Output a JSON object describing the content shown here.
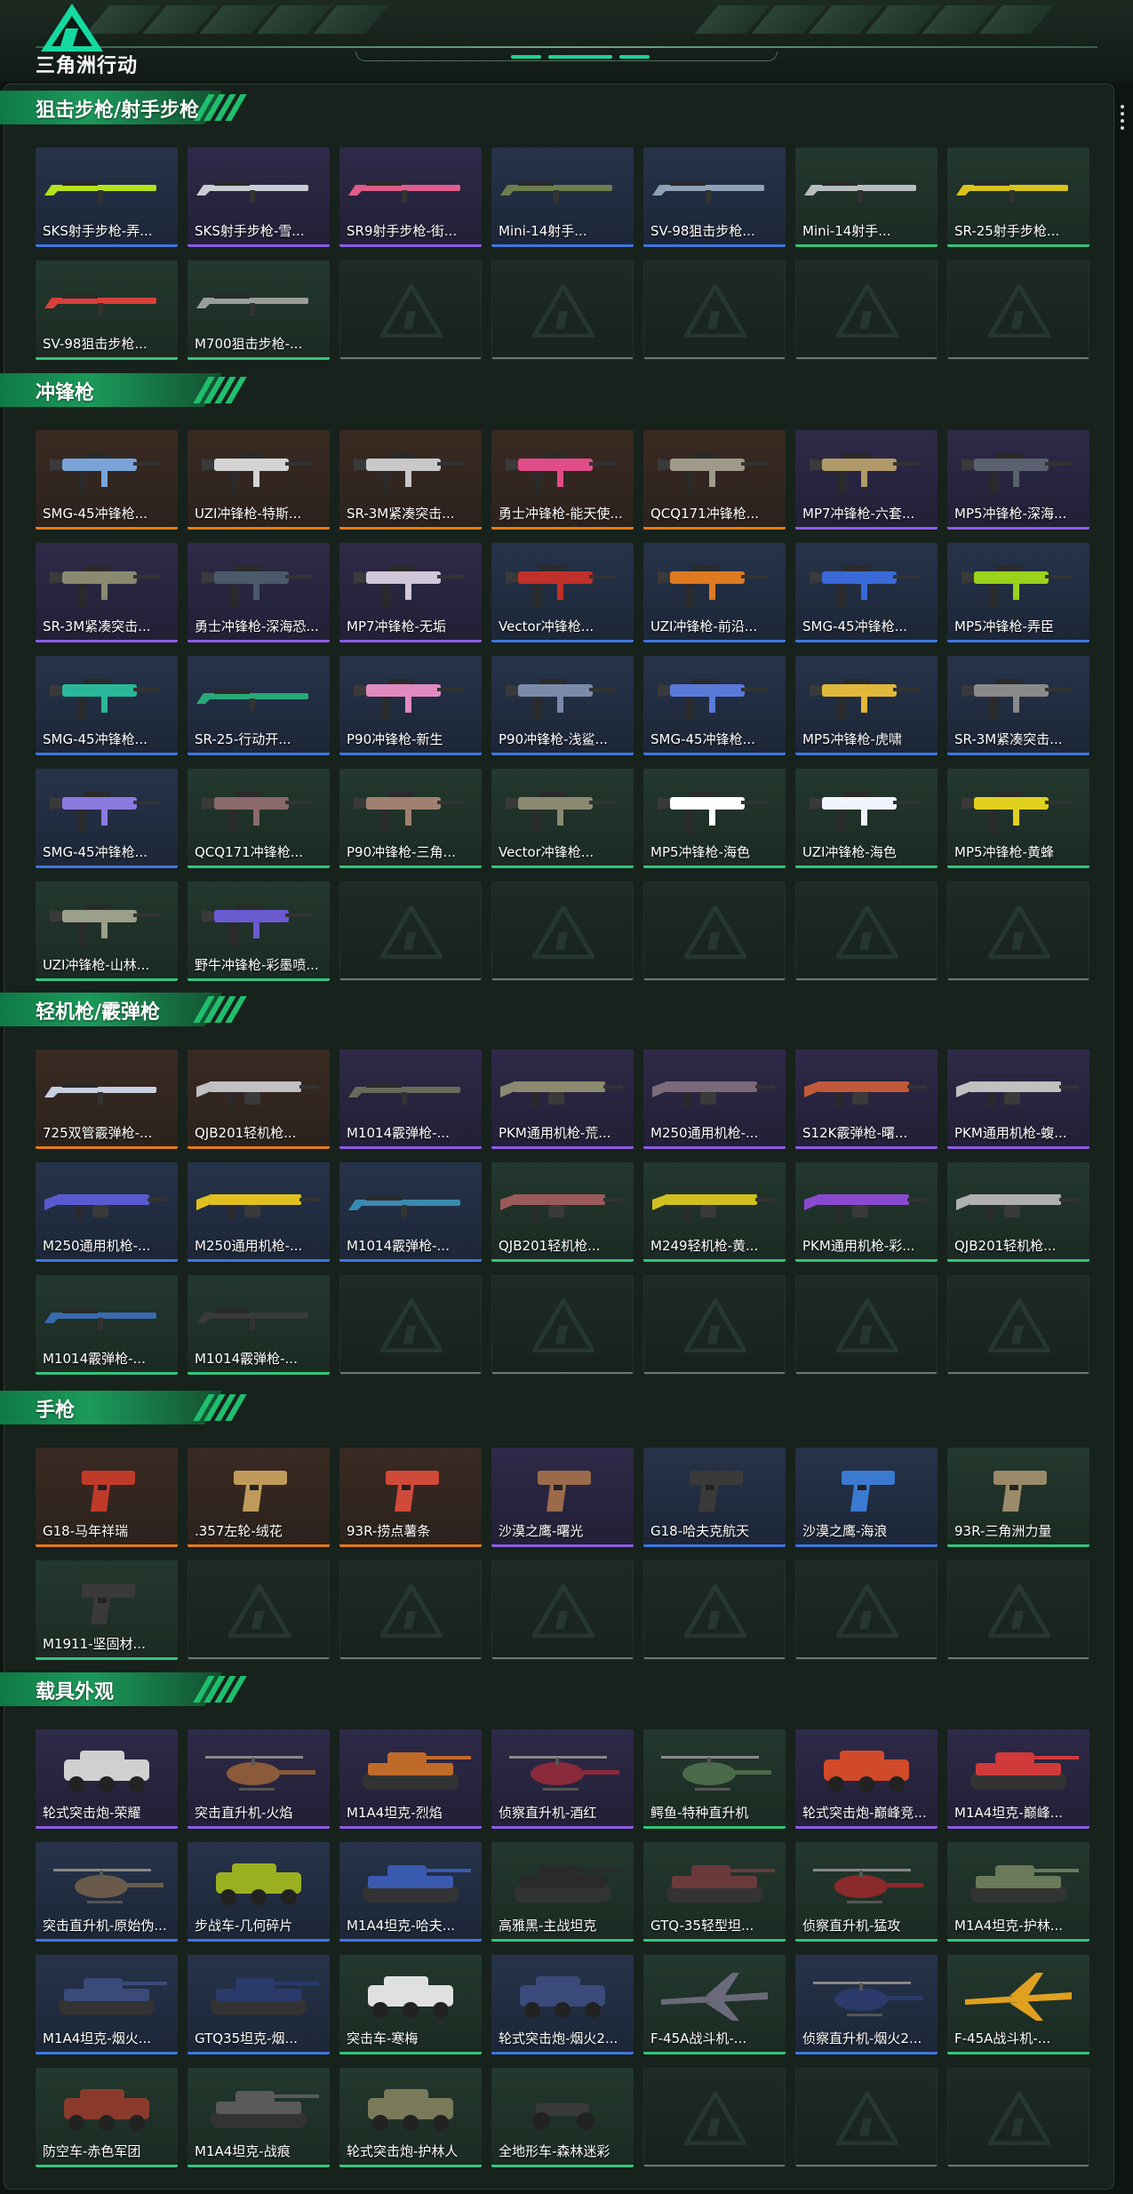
{
  "header": {
    "logo_text": "三角洲行动"
  },
  "colors": {
    "accent": "#1fbf6e",
    "rarity_orange": "#e57a19",
    "rarity_purple": "#8d5be8",
    "rarity_blue": "#3d76e0",
    "rarity_green": "#34c57c"
  },
  "sections": [
    {
      "title": "狙击步枪/射手步枪",
      "items": [
        {
          "name": "SKS射手步枪-弄...",
          "rarity": "blue",
          "kind": "rifle",
          "color": "#b6e21c"
        },
        {
          "name": "SKS射手步枪-雪...",
          "rarity": "purple",
          "kind": "rifle",
          "color": "#c9cdd3"
        },
        {
          "name": "SR9射手步枪-街...",
          "rarity": "purple",
          "kind": "rifle",
          "color": "#e05c8a"
        },
        {
          "name": "Mini-14射手...",
          "rarity": "blue",
          "kind": "rifle",
          "color": "#6d7e4e"
        },
        {
          "name": "SV-98狙击步枪...",
          "rarity": "blue",
          "kind": "rifle",
          "color": "#8ea1b7"
        },
        {
          "name": "Mini-14射手...",
          "rarity": "green",
          "kind": "rifle",
          "color": "#b7bdbf"
        },
        {
          "name": "SR-25射手步枪...",
          "rarity": "green",
          "kind": "rifle",
          "color": "#d8c31c"
        },
        {
          "name": "SV-98狙击步枪...",
          "rarity": "green",
          "kind": "rifle",
          "color": "#d8403a"
        },
        {
          "name": "M700狙击步枪-...",
          "rarity": "green",
          "kind": "rifle",
          "color": "#9a9e98"
        },
        {
          "empty": true
        },
        {
          "empty": true
        },
        {
          "empty": true
        },
        {
          "empty": true
        },
        {
          "empty": true
        }
      ]
    },
    {
      "title": "冲锋枪",
      "items": [
        {
          "name": "SMG-45冲锋枪...",
          "rarity": "orange",
          "kind": "smg",
          "color": "#7aa4d8"
        },
        {
          "name": "UZI冲锋枪-特斯...",
          "rarity": "orange",
          "kind": "smg",
          "color": "#d4d4d4"
        },
        {
          "name": "SR-3M紧凑突击...",
          "rarity": "orange",
          "kind": "smg",
          "color": "#c8c8c8"
        },
        {
          "name": "勇士冲锋枪-能天使...",
          "rarity": "orange",
          "kind": "smg",
          "color": "#e04d89"
        },
        {
          "name": "QCQ171冲锋枪...",
          "rarity": "orange",
          "kind": "smg",
          "color": "#9f9a8a"
        },
        {
          "name": "MP7冲锋枪-六套...",
          "rarity": "purple",
          "kind": "smg",
          "color": "#b09a6a"
        },
        {
          "name": "MP5冲锋枪-深海...",
          "rarity": "purple",
          "kind": "smg",
          "color": "#5a6070"
        },
        {
          "name": "SR-3M紧凑突击...",
          "rarity": "purple",
          "kind": "smg",
          "color": "#8a8a70"
        },
        {
          "name": "勇士冲锋枪-深海恐...",
          "rarity": "purple",
          "kind": "smg",
          "color": "#4a5a6a"
        },
        {
          "name": "MP7冲锋枪-无垢",
          "rarity": "purple",
          "kind": "smg",
          "color": "#d0c8d8"
        },
        {
          "name": "Vector冲锋枪...",
          "rarity": "blue",
          "kind": "smg",
          "color": "#c0302a"
        },
        {
          "name": "UZI冲锋枪-前沿...",
          "rarity": "blue",
          "kind": "smg",
          "color": "#e07a20"
        },
        {
          "name": "SMG-45冲锋枪...",
          "rarity": "blue",
          "kind": "smg",
          "color": "#3a6ad8"
        },
        {
          "name": "MP5冲锋枪-弄臣",
          "rarity": "blue",
          "kind": "smg",
          "color": "#9ad21c"
        },
        {
          "name": "SMG-45冲锋枪...",
          "rarity": "blue",
          "kind": "smg",
          "color": "#2ab89a"
        },
        {
          "name": "SR-25-行动开...",
          "rarity": "blue",
          "kind": "rifle",
          "color": "#28a878"
        },
        {
          "name": "P90冲锋枪-新生",
          "rarity": "blue",
          "kind": "smg",
          "color": "#e08ac0"
        },
        {
          "name": "P90冲锋枪-浅鲨...",
          "rarity": "blue",
          "kind": "smg",
          "color": "#7a8aa8"
        },
        {
          "name": "SMG-45冲锋枪...",
          "rarity": "blue",
          "kind": "smg",
          "color": "#5a7ad8"
        },
        {
          "name": "MP5冲锋枪-虎啸",
          "rarity": "blue",
          "kind": "smg",
          "color": "#e0b83a"
        },
        {
          "name": "SR-3M紧凑突击...",
          "rarity": "blue",
          "kind": "smg",
          "color": "#8a8a8a"
        },
        {
          "name": "SMG-45冲锋枪...",
          "rarity": "blue",
          "kind": "smg",
          "color": "#8a7ae0"
        },
        {
          "name": "QCQ171冲锋枪...",
          "rarity": "green",
          "kind": "smg",
          "color": "#8a6a6a"
        },
        {
          "name": "P90冲锋枪-三角...",
          "rarity": "green",
          "kind": "smg",
          "color": "#a08070"
        },
        {
          "name": "Vector冲锋枪...",
          "rarity": "green",
          "kind": "smg",
          "color": "#8a8a70"
        },
        {
          "name": "MP5冲锋枪-海色",
          "rarity": "green",
          "kind": "smg",
          "color": "#ffffff"
        },
        {
          "name": "UZI冲锋枪-海色",
          "rarity": "green",
          "kind": "smg",
          "color": "#f0f4ff"
        },
        {
          "name": "MP5冲锋枪-黄蜂",
          "rarity": "green",
          "kind": "smg",
          "color": "#e0d020"
        },
        {
          "name": "UZI冲锋枪-山林...",
          "rarity": "green",
          "kind": "smg",
          "color": "#9aa08a"
        },
        {
          "name": "野牛冲锋枪-彩墨喷...",
          "rarity": "green",
          "kind": "smg",
          "color": "#6a5ad0"
        },
        {
          "empty": true
        },
        {
          "empty": true
        },
        {
          "empty": true
        },
        {
          "empty": true
        },
        {
          "empty": true
        }
      ]
    },
    {
      "title": "轻机枪/霰弹枪",
      "items": [
        {
          "name": "725双管霰弹枪-...",
          "rarity": "orange",
          "kind": "rifle",
          "color": "#c8d0e0"
        },
        {
          "name": "QJB201轻机枪...",
          "rarity": "orange",
          "kind": "lmg",
          "color": "#c0c0c0"
        },
        {
          "name": "M1014霰弹枪-...",
          "rarity": "purple",
          "kind": "rifle",
          "color": "#6a6a5a"
        },
        {
          "name": "PKM通用机枪-荒...",
          "rarity": "purple",
          "kind": "lmg",
          "color": "#8a8a70"
        },
        {
          "name": "M250通用机枪-...",
          "rarity": "purple",
          "kind": "lmg",
          "color": "#7a6a7a"
        },
        {
          "name": "S12K霰弹枪-曙...",
          "rarity": "purple",
          "kind": "lmg",
          "color": "#c05a3a"
        },
        {
          "name": "PKM通用机枪-蝮...",
          "rarity": "purple",
          "kind": "lmg",
          "color": "#c0c0c0"
        },
        {
          "name": "M250通用机枪-...",
          "rarity": "blue",
          "kind": "lmg",
          "color": "#5a5ad0"
        },
        {
          "name": "M250通用机枪-...",
          "rarity": "blue",
          "kind": "lmg",
          "color": "#e0c020"
        },
        {
          "name": "M1014霰弹枪-...",
          "rarity": "blue",
          "kind": "rifle",
          "color": "#3a8ab0"
        },
        {
          "name": "QJB201轻机枪...",
          "rarity": "green",
          "kind": "lmg",
          "color": "#9a5a5a"
        },
        {
          "name": "M249轻机枪-黄...",
          "rarity": "green",
          "kind": "lmg",
          "color": "#d0c020"
        },
        {
          "name": "PKM通用机枪-彩...",
          "rarity": "green",
          "kind": "lmg",
          "color": "#8a4ad0"
        },
        {
          "name": "QJB201轻机枪...",
          "rarity": "green",
          "kind": "lmg",
          "color": "#b0b0b0"
        },
        {
          "name": "M1014霰弹枪-...",
          "rarity": "green",
          "kind": "rifle",
          "color": "#3a6ab0"
        },
        {
          "name": "M1014霰弹枪-...",
          "rarity": "green",
          "kind": "rifle",
          "color": "#3a3a3a"
        },
        {
          "empty": true
        },
        {
          "empty": true
        },
        {
          "empty": true
        },
        {
          "empty": true
        },
        {
          "empty": true
        }
      ]
    },
    {
      "title": "手枪",
      "items": [
        {
          "name": "G18-马年祥瑞",
          "rarity": "orange",
          "kind": "pistol",
          "color": "#c03a2a"
        },
        {
          "name": ".357左轮-绒花",
          "rarity": "orange",
          "kind": "pistol",
          "color": "#c09a5a"
        },
        {
          "name": "93R-捞点薯条",
          "rarity": "orange",
          "kind": "pistol",
          "color": "#d04a3a"
        },
        {
          "name": "沙漠之鹰-曙光",
          "rarity": "purple",
          "kind": "pistol",
          "color": "#9a6a4a"
        },
        {
          "name": "G18-哈夫克航天",
          "rarity": "blue",
          "kind": "pistol",
          "color": "#3a3a3a"
        },
        {
          "name": "沙漠之鹰-海浪",
          "rarity": "blue",
          "kind": "pistol",
          "color": "#3a7ad0"
        },
        {
          "name": "93R-三角洲力量",
          "rarity": "green",
          "kind": "pistol",
          "color": "#9a8a6a"
        },
        {
          "name": "M1911-坚固材...",
          "rarity": "green",
          "kind": "pistol",
          "color": "#3a3a3a"
        },
        {
          "empty": true
        },
        {
          "empty": true
        },
        {
          "empty": true
        },
        {
          "empty": true
        },
        {
          "empty": true
        },
        {
          "empty": true
        }
      ]
    },
    {
      "title": "载具外观",
      "items": [
        {
          "name": "轮式突击炮-荣耀",
          "rarity": "purple",
          "kind": "car",
          "color": "#d0d0d0"
        },
        {
          "name": "突击直升机-火焰",
          "rarity": "purple",
          "kind": "heli",
          "color": "#8a5a3a"
        },
        {
          "name": "M1A4坦克-烈焰",
          "rarity": "purple",
          "kind": "tank",
          "color": "#c06a2a"
        },
        {
          "name": "侦察直升机-酒红",
          "rarity": "purple",
          "kind": "heli",
          "color": "#8a2a3a"
        },
        {
          "name": "鳄鱼-特种直升机",
          "rarity": "green",
          "kind": "heli",
          "color": "#4a6a4a"
        },
        {
          "name": "轮式突击炮-巅峰竞...",
          "rarity": "purple",
          "kind": "car",
          "color": "#d04a2a"
        },
        {
          "name": "M1A4坦克-巅峰...",
          "rarity": "purple",
          "kind": "tank",
          "color": "#d03a3a"
        },
        {
          "name": "突击直升机-原始伪...",
          "rarity": "blue",
          "kind": "heli",
          "color": "#6a5a4a"
        },
        {
          "name": "步战车-几何碎片",
          "rarity": "blue",
          "kind": "car",
          "color": "#9ab020"
        },
        {
          "name": "M1A4坦克-哈夫...",
          "rarity": "blue",
          "kind": "tank",
          "color": "#3a5ab0"
        },
        {
          "name": "高雅黑-主战坦克",
          "rarity": "green",
          "kind": "tank",
          "color": "#2a2a2a"
        },
        {
          "name": "GTQ-35轻型坦...",
          "rarity": "green",
          "kind": "tank",
          "color": "#6a3a3a"
        },
        {
          "name": "侦察直升机-猛攻",
          "rarity": "green",
          "kind": "heli",
          "color": "#8a2a2a"
        },
        {
          "name": "M1A4坦克-护林...",
          "rarity": "green",
          "kind": "tank",
          "color": "#6a7a5a"
        },
        {
          "name": "M1A4坦克-烟火...",
          "rarity": "blue",
          "kind": "tank",
          "color": "#3a4a7a"
        },
        {
          "name": "GTQ35坦克-烟...",
          "rarity": "blue",
          "kind": "tank",
          "color": "#2a3a6a"
        },
        {
          "name": "突击车-寒梅",
          "rarity": "green",
          "kind": "car",
          "color": "#e0e0e0"
        },
        {
          "name": "轮式突击炮-烟火2...",
          "rarity": "blue",
          "kind": "car",
          "color": "#3a4a7a"
        },
        {
          "name": "F-45A战斗机-...",
          "rarity": "green",
          "kind": "jet",
          "color": "#6a6a7a"
        },
        {
          "name": "侦察直升机-烟火2...",
          "rarity": "blue",
          "kind": "heli",
          "color": "#2a3a6a"
        },
        {
          "name": "F-45A战斗机-...",
          "rarity": "green",
          "kind": "jet",
          "color": "#e0a020"
        },
        {
          "name": "防空车-赤色军团",
          "rarity": "green",
          "kind": "car",
          "color": "#8a3a2a"
        },
        {
          "name": "M1A4坦克-战痕",
          "rarity": "green",
          "kind": "tank",
          "color": "#5a5a5a"
        },
        {
          "name": "轮式突击炮-护林人",
          "rarity": "green",
          "kind": "car",
          "color": "#7a7a5a"
        },
        {
          "name": "全地形车-森林迷彩",
          "rarity": "green",
          "kind": "atv",
          "color": "#3a3a3a"
        },
        {
          "empty": true
        },
        {
          "empty": true
        },
        {
          "empty": true
        }
      ]
    }
  ]
}
